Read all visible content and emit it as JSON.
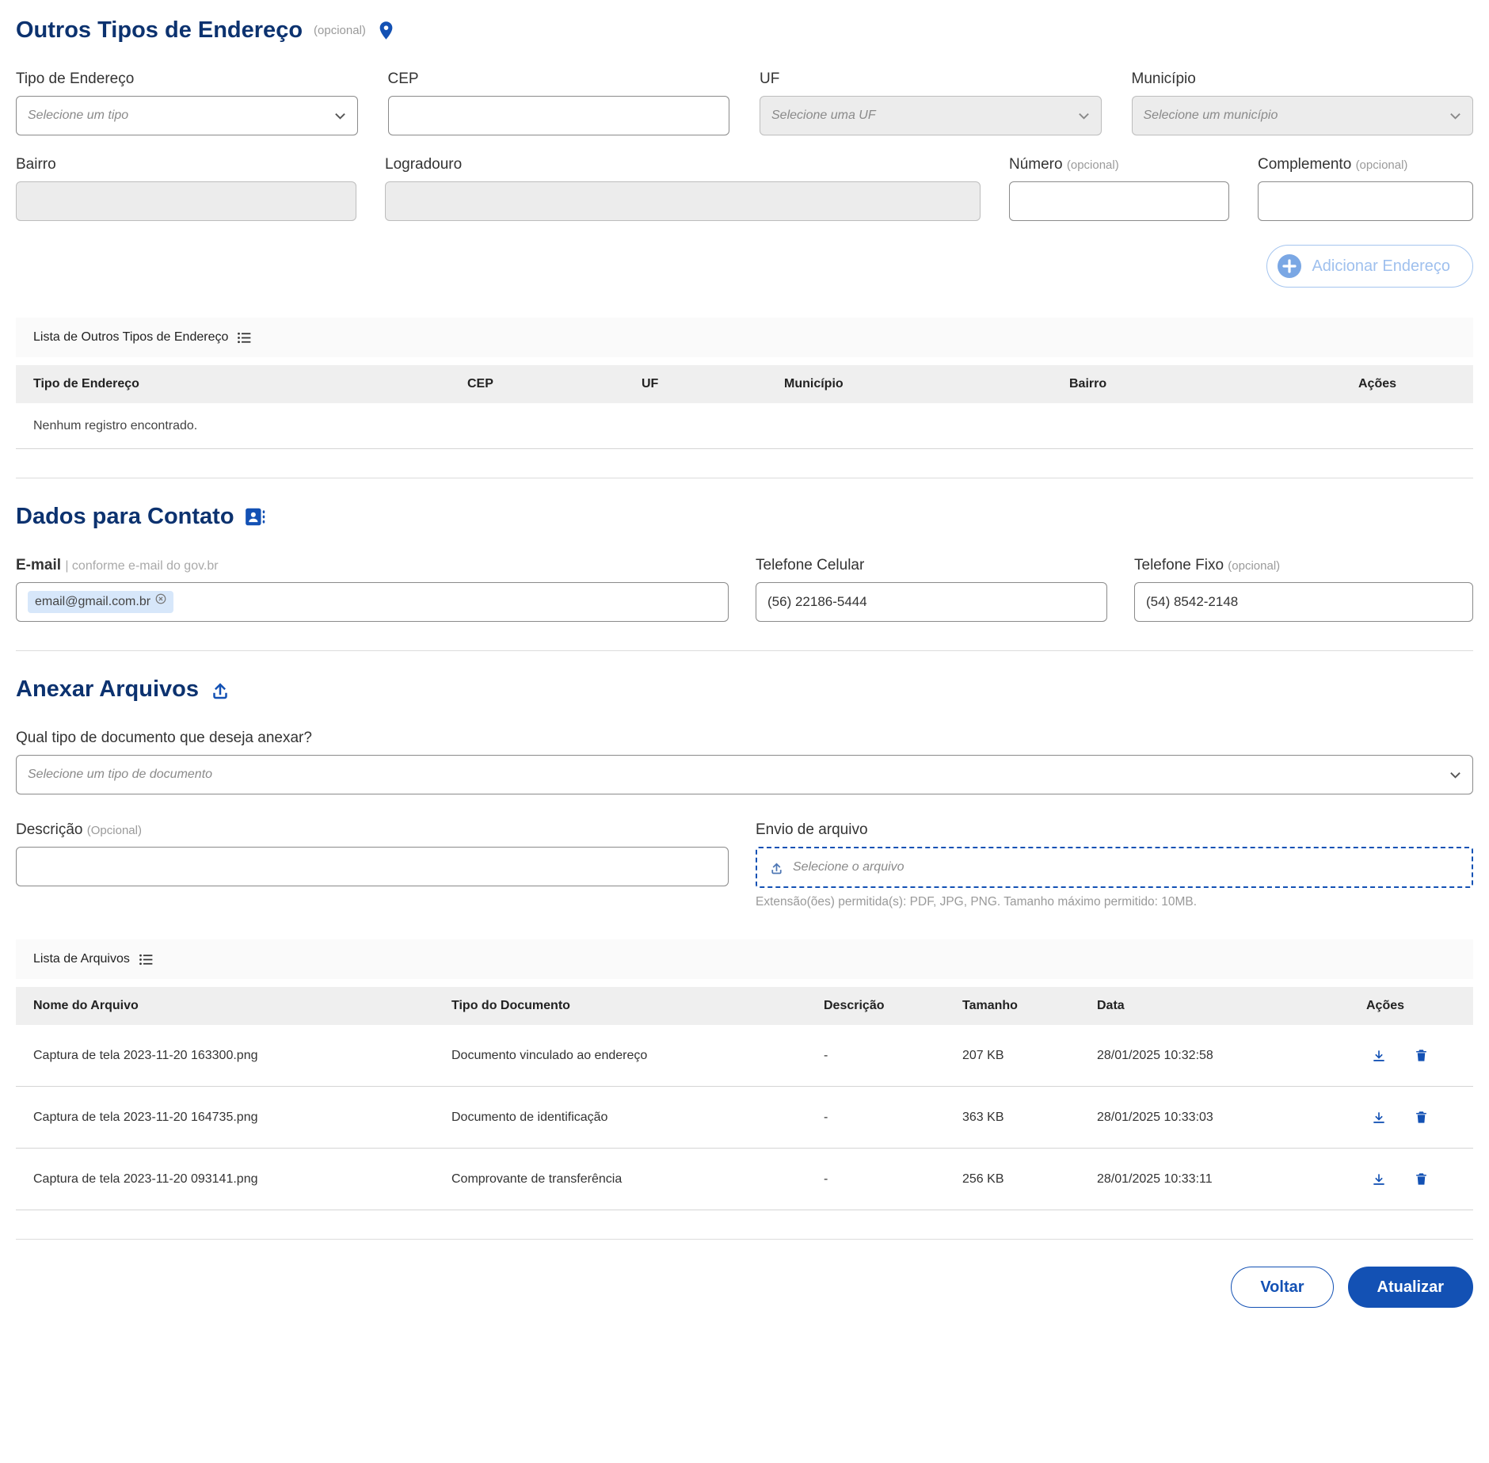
{
  "colors": {
    "accent": "#1351b4",
    "heading": "#0c326f"
  },
  "address": {
    "title": "Outros Tipos de Endereço",
    "optional_tag": "(opcional)",
    "fields": {
      "tipo_label": "Tipo de Endereço",
      "tipo_placeholder": "Selecione um tipo",
      "cep_label": "CEP",
      "uf_label": "UF",
      "uf_placeholder": "Selecione uma UF",
      "municipio_label": "Município",
      "municipio_placeholder": "Selecione um município",
      "bairro_label": "Bairro",
      "logradouro_label": "Logradouro",
      "numero_label": "Número",
      "numero_optional": "(opcional)",
      "complemento_label": "Complemento",
      "complemento_optional": "(opcional)"
    },
    "add_button_label": "Adicionar Endereço",
    "list_title": "Lista de Outros Tipos de Endereço",
    "table_headers": [
      "Tipo de Endereço",
      "CEP",
      "UF",
      "Município",
      "Bairro",
      "Ações"
    ],
    "empty_message": "Nenhum registro encontrado."
  },
  "contact": {
    "title": "Dados para Contato",
    "email_label": "E-mail",
    "email_hint": "| conforme e-mail do gov.br",
    "email_value": "email@gmail.com.br",
    "cel_label": "Telefone Celular",
    "cel_value": "(56) 22186-5444",
    "fixo_label": "Telefone Fixo",
    "fixo_optional": "(opcional)",
    "fixo_value": "(54) 8542-2148"
  },
  "attachments": {
    "title": "Anexar Arquivos",
    "doc_type_label": "Qual tipo de documento que deseja anexar?",
    "doc_type_placeholder": "Selecione um tipo de documento",
    "desc_label": "Descrição",
    "desc_optional": "(Opcional)",
    "upload_label": "Envio de arquivo",
    "upload_placeholder": "Selecione o arquivo",
    "upload_hint": "Extensão(ões) permitida(s): PDF, JPG, PNG. Tamanho máximo permitido: 10MB.",
    "list_title": "Lista de Arquivos",
    "table_headers": [
      "Nome do Arquivo",
      "Tipo do Documento",
      "Descrição",
      "Tamanho",
      "Data",
      "Ações"
    ],
    "rows": [
      {
        "name": "Captura de tela 2023-11-20 163300.png",
        "type": "Documento vinculado ao endereço",
        "desc": "-",
        "size": "207 KB",
        "date": "28/01/2025 10:32:58"
      },
      {
        "name": "Captura de tela 2023-11-20 164735.png",
        "type": "Documento de identificação",
        "desc": "-",
        "size": "363 KB",
        "date": "28/01/2025 10:33:03"
      },
      {
        "name": "Captura de tela 2023-11-20 093141.png",
        "type": "Comprovante de transferência",
        "desc": "-",
        "size": "256 KB",
        "date": "28/01/2025 10:33:11"
      }
    ]
  },
  "footer": {
    "back_label": "Voltar",
    "submit_label": "Atualizar"
  }
}
